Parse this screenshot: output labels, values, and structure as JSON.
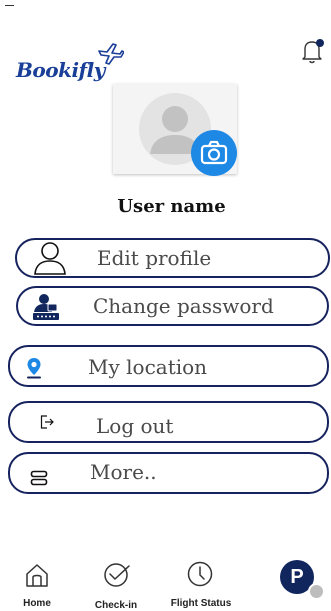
{
  "app": {
    "logo_text": "Bookifly"
  },
  "profile": {
    "username": "User name"
  },
  "menu": {
    "edit_profile": "Edit profile",
    "change_password": "Change password",
    "my_location": "My location",
    "log_out": "Log out",
    "more": "More.."
  },
  "bottom_nav": {
    "home": "Home",
    "check_in": "Check-in",
    "flight_status": "Flight Status",
    "profile_initial": "P"
  },
  "colors": {
    "brand": "#1a3f98",
    "outline": "#16235e",
    "camera": "#1e88e5",
    "location_pin": "#1e88e5"
  },
  "icons": [
    "plane-icon",
    "bell-icon",
    "camera-icon",
    "user-outline-icon",
    "user-lock-icon",
    "location-pin-icon",
    "logout-icon",
    "menu-icon",
    "home-icon",
    "check-circle-icon",
    "clock-icon"
  ]
}
